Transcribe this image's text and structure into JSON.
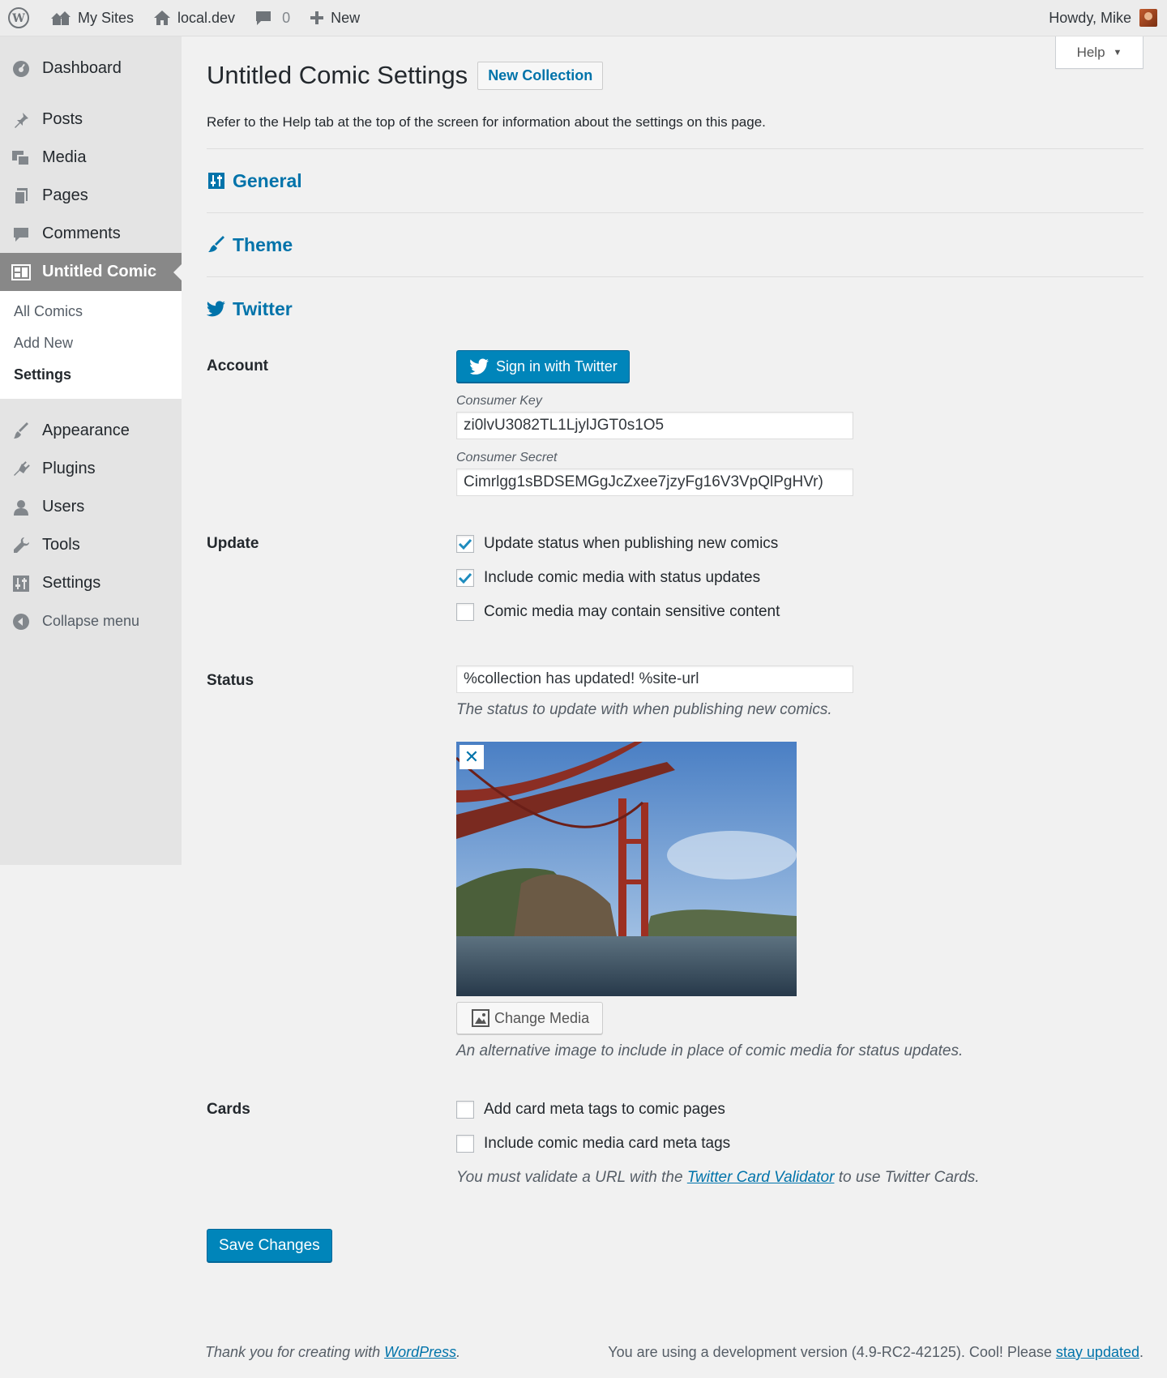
{
  "adminbar": {
    "my_sites": "My Sites",
    "site": "local.dev",
    "comments_count": "0",
    "new": "New",
    "howdy": "Howdy, Mike"
  },
  "sidebar": {
    "items": [
      {
        "label": "Dashboard",
        "icon": "dashboard-icon"
      },
      {
        "label": "Posts",
        "icon": "pin-icon"
      },
      {
        "label": "Media",
        "icon": "media-icon"
      },
      {
        "label": "Pages",
        "icon": "pages-icon"
      },
      {
        "label": "Comments",
        "icon": "comment-icon"
      },
      {
        "label": "Untitled Comic",
        "icon": "comic-icon"
      }
    ],
    "submenu": [
      "All Comics",
      "Add New",
      "Settings"
    ],
    "items_after": [
      {
        "label": "Appearance",
        "icon": "brush-icon"
      },
      {
        "label": "Plugins",
        "icon": "plugin-icon"
      },
      {
        "label": "Users",
        "icon": "user-icon"
      },
      {
        "label": "Tools",
        "icon": "wrench-icon"
      },
      {
        "label": "Settings",
        "icon": "sliders-icon"
      }
    ],
    "collapse": "Collapse menu"
  },
  "help_tab": "Help",
  "page": {
    "title": "Untitled Comic Settings",
    "new_collection": "New Collection",
    "intro": "Refer to the Help tab at the top of the screen for information about the settings on this page."
  },
  "sections": {
    "general": "General",
    "theme": "Theme",
    "twitter": "Twitter"
  },
  "account": {
    "label": "Account",
    "sign_in": "Sign in with Twitter",
    "consumer_key_label": "Consumer Key",
    "consumer_key": "zi0lvU3082TL1LjylJGT0s1O5",
    "consumer_secret_label": "Consumer Secret",
    "consumer_secret": "Cimrlgg1sBDSEMGgJcZxee7jzyFg16V3VpQlPgHVr)"
  },
  "update": {
    "label": "Update",
    "options": [
      {
        "label": "Update status when publishing new comics",
        "checked": true
      },
      {
        "label": "Include comic media with status updates",
        "checked": true
      },
      {
        "label": "Comic media may contain sensitive content",
        "checked": false
      }
    ]
  },
  "status": {
    "label": "Status",
    "value": "%collection has updated! %site-url",
    "description": "The status to update with when publishing new comics.",
    "change_media": "Change Media",
    "media_description": "An alternative image to include in place of comic media for status updates."
  },
  "cards": {
    "label": "Cards",
    "options": [
      {
        "label": "Add card meta tags to comic pages",
        "checked": false
      },
      {
        "label": "Include comic media card meta tags",
        "checked": false
      }
    ],
    "desc_before": "You must validate a URL with the ",
    "desc_link": "Twitter Card Validator",
    "desc_after": " to use Twitter Cards."
  },
  "save": "Save Changes",
  "footer": {
    "thanks_before": "Thank you for creating with ",
    "thanks_link": "WordPress",
    "thanks_after": ".",
    "version_before": "You are using a development version (4.9-RC2-42125). Cool! Please ",
    "version_link": "stay updated",
    "version_after": "."
  },
  "colors": {
    "accent": "#0073aa",
    "primary_button": "#0085ba",
    "sidebar_bg": "#e4e4e4",
    "current_menu_bg": "#888888"
  }
}
